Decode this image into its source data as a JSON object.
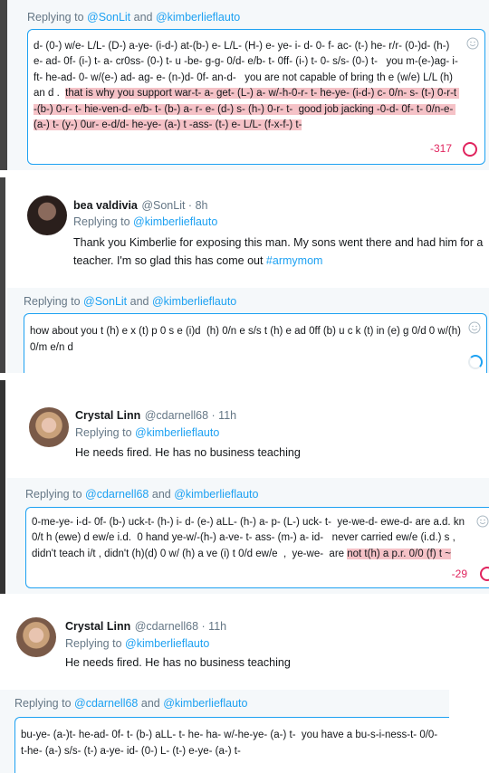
{
  "block1": {
    "reply_prefix": "Replying to ",
    "reply_handle1": "@SonLit",
    "reply_and": " and ",
    "reply_handle2": "@kimberlieflauto",
    "text_plain": "d- (0-) w/e- L/L- (D-) a-ye- (i-d-) at-(b-) e- L/L- (H-) e- ye- i- d- 0- f- ac- (t-) he- r/r- (0-)d- (h-) e- ad- 0f- (i-) t- a- cr0ss- (0-) t- u -be- g-g- 0/d- e/b- t- 0ff- (i-) t- 0- s/s- (0-) t-   you m-(e-)ag- i- ft- he-ad- 0- w/(e-) ad- ag- e- (n-)d- 0f- an-d-   you are not capable of bring th e (w/e) L/L (h) an d .  ",
    "text_highlight": "that is why you support war-t- a- get- (L-) a- w/-h-0-r- t- he-ye- (i-d-) c- 0/n- s- (t-) 0-r-t -(b-) 0-r- t- hie-ven-d- e/b- t- (b-) a- r- e- (d-) s- (h-) 0-r- t-  good job jacking -0-d- 0f- t- 0/n-e- (a-) t- (y-) 0ur- e-d/d- he-ye- (a-) t -ass- (t-) e- L/L- (f-x-f-) t-",
    "counter": "-317"
  },
  "tweet1": {
    "name": "bea valdivia",
    "handle_time": "@SonLit · 8h",
    "replying": "Replying to ",
    "replying_handle": "@kimberlieflauto",
    "text": "Thank you Kimberlie for exposing this man. My sons went there and had him for a teacher. I'm so glad this has come out ",
    "hashtag": "#armymom"
  },
  "block2": {
    "reply_prefix": "Replying to ",
    "reply_handle1": "@SonLit",
    "reply_and": " and ",
    "reply_handle2": "@kimberlieflauto",
    "text": "how about you t (h) e x (t) p 0 s e (i)d  (h) 0/n e s/s t (h) e ad 0ff (b) u c k (t) in (e) g 0/d 0 w/(h) 0/m e/n d"
  },
  "tweet2": {
    "name": "Crystal Linn",
    "handle_time": "@cdarnell68 · 11h",
    "replying": "Replying to ",
    "replying_handle": "@kimberlieflauto",
    "text": "He needs fired. He has no business teaching"
  },
  "block3": {
    "reply_prefix": "Replying to ",
    "reply_handle1": "@cdarnell68",
    "reply_and": " and ",
    "reply_handle2": "@kimberlieflauto",
    "text_plain": "0-me-ye- i-d- 0f- (b-) uck-t- (h-) i- d- (e-) aLL- (h-) a- p- (L-) uck- t-  ye-we-d- ewe-d- are a.d. kn 0/t h (ewe) d ew/e i.d.  0 hand ye-w/-(h-) a-ve- t- ass- (m-) a- id-   never carried ew/e (i.d.) s , didn't teach i/t , didn't (h)(d) 0 w/ (h) a ve (i) t 0/d ew/e  ,  ye-we-  are ",
    "text_highlight": "not t(h) a p.r. 0/0 (f) t ~",
    "counter": "-29"
  },
  "tweet3": {
    "name": "Crystal Linn",
    "handle_time": "@cdarnell68 · 11h",
    "replying": "Replying to ",
    "replying_handle": "@kimberlieflauto",
    "text": "He needs fired. He has no business teaching"
  },
  "block4": {
    "reply_prefix": "Replying to ",
    "reply_handle1": "@cdarnell68",
    "reply_and": " and ",
    "reply_handle2": "@kimberlieflauto",
    "text": "bu-ye- (a-)t- he-ad- 0f- t- (b-) aLL- t- he- ha- w/-he-ye- (a-) t-  you have a bu-s-i-ness-t- 0/0-t-he- (a-) s/s- (t-) a-ye- id- (0-) L- (t-) e-ye- (a-) t-"
  },
  "colors": {
    "accent": "#1da1f2",
    "error": "#e0245e",
    "highlight": "#f5c2c7",
    "panel_bg": "#f5f8fa"
  }
}
